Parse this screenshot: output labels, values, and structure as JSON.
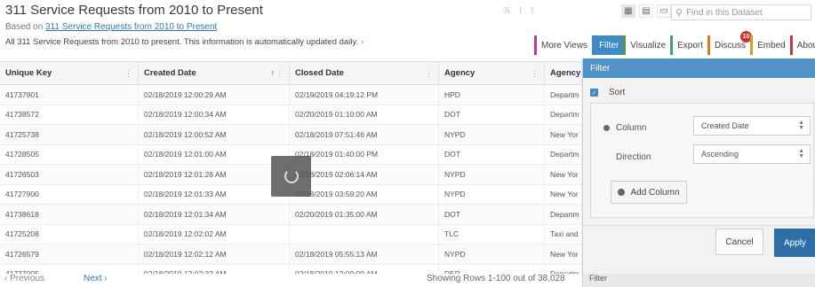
{
  "header": {
    "title": "311 Service Requests from 2010 to Present",
    "based_on_prefix": "Based on",
    "based_on_link": "311 Service Requests from 2010 to Present",
    "description": "All 311 Service Requests from 2010 to present. This information is automatically updated daily.",
    "more_icon": "›"
  },
  "share": {
    "rss": "ℜ",
    "facebook": "f",
    "twitter": "𝕥"
  },
  "view_buttons": [
    "▦",
    "▤",
    "▭"
  ],
  "search": {
    "icon": "⚲",
    "placeholder": "Find in this Dataset"
  },
  "tabs": [
    {
      "label": "More Views",
      "color": "#b83d9a"
    },
    {
      "label": "Filter",
      "color": "#3d8ac6"
    },
    {
      "label": "Visualize",
      "color": "#5c9a2e"
    },
    {
      "label": "Export",
      "color": "#3aa66a"
    },
    {
      "label": "Discuss",
      "color": "#e07a1f",
      "badge": "10"
    },
    {
      "label": "Embed",
      "color": "#c9a21f"
    },
    {
      "label": "About",
      "color": "#c13d3d"
    }
  ],
  "table": {
    "columns": [
      "Unique Key",
      "Created Date",
      "Closed Date",
      "Agency",
      "Agency"
    ],
    "menu_icon": "⋮",
    "sort_icon": "↑",
    "rows": [
      [
        "41737901",
        "02/18/2019 12:00:29 AM",
        "02/19/2019 04:19:12 PM",
        "HPD",
        "Departm"
      ],
      [
        "41738572",
        "02/18/2019 12:00:34 AM",
        "02/20/2019 01:10:00 AM",
        "DOT",
        "Departm"
      ],
      [
        "41725738",
        "02/18/2019 12:00:52 AM",
        "02/18/2019 07:51:46 AM",
        "NYPD",
        "New Yor"
      ],
      [
        "41728505",
        "02/18/2019 12:01:00 AM",
        "02/18/2019 01:40:00 PM",
        "DOT",
        "Departm"
      ],
      [
        "41726503",
        "02/18/2019 12:01:28 AM",
        "02/18/2019 02:06:14 AM",
        "NYPD",
        "New Yor"
      ],
      [
        "41727900",
        "02/18/2019 12:01:33 AM",
        "02/18/2019 03:59:20 AM",
        "NYPD",
        "New Yor"
      ],
      [
        "41738618",
        "02/18/2019 12:01:34 AM",
        "02/20/2019 01:35:00 AM",
        "DOT",
        "Departm"
      ],
      [
        "41725208",
        "02/18/2019 12:02:02 AM",
        "",
        "TLC",
        "Taxi and"
      ],
      [
        "41726579",
        "02/18/2019 12:02:12 AM",
        "02/18/2019 05:55:13 AM",
        "NYPD",
        "New Yor"
      ],
      [
        "41737005",
        "02/18/2019 12:02:33 AM",
        "02/18/2019 12:09:09 AM",
        "DEP",
        "Departm"
      ]
    ]
  },
  "footer": {
    "previous": "‹ Previous",
    "next": "Next ›",
    "showing": "Showing Rows 1-100 out of 38,028",
    "filter_label": "Filter"
  },
  "filter_panel": {
    "title": "Filter",
    "sort_label": "Sort",
    "column_label": "Column",
    "column_value": "Created Date",
    "direction_label": "Direction",
    "direction_value": "Ascending",
    "add_column": "Add Column",
    "cancel": "Cancel",
    "apply": "Apply"
  }
}
